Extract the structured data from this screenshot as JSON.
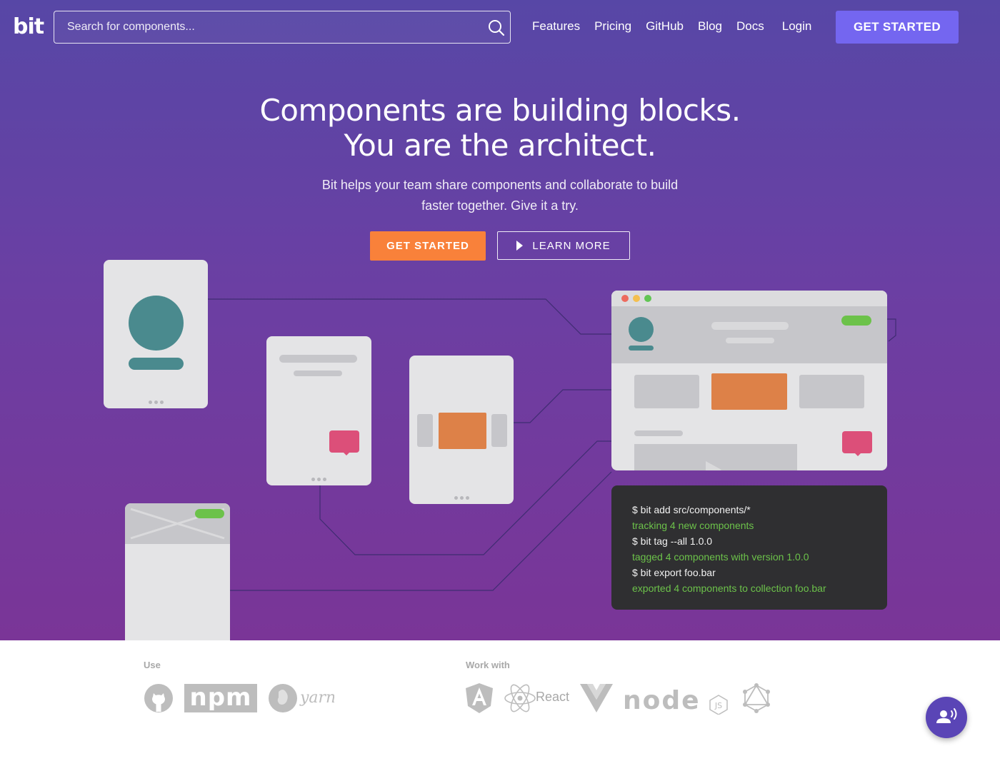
{
  "nav": {
    "logo": "bit",
    "search_placeholder": "Search for components...",
    "links": [
      "Features",
      "Pricing",
      "GitHub",
      "Blog",
      "Docs"
    ],
    "login": "Login",
    "cta": "GET STARTED"
  },
  "hero": {
    "title_line1": "Components are building blocks.",
    "title_line2": "You are the architect.",
    "subtitle_line1": "Bit helps your team share components and collaborate to build",
    "subtitle_line2": "faster together. Give it a try.",
    "primary_button": "GET STARTED",
    "secondary_button": "LEARN MORE"
  },
  "terminal": [
    {
      "type": "cmd",
      "text": "$ bit add src/components/*"
    },
    {
      "type": "out",
      "text": "tracking 4 new components"
    },
    {
      "type": "cmd",
      "text": "$ bit tag --all 1.0.0"
    },
    {
      "type": "out",
      "text": "tagged 4 components with version 1.0.0"
    },
    {
      "type": "cmd",
      "text": "$ bit export foo.bar"
    },
    {
      "type": "out",
      "text": "exported 4 components to collection foo.bar"
    }
  ],
  "bottom": {
    "use_label": "Use",
    "work_label": "Work with",
    "use_logos": [
      "github-logo",
      "npm-logo",
      "yarn-logo"
    ],
    "work_logos": [
      "angular-logo",
      "react-logo",
      "vue-logo",
      "nodejs-logo",
      "graphql-logo"
    ],
    "npm_text": "npm",
    "yarn_text": "yarn",
    "react_text": "React",
    "node_text": "node",
    "node_badge": "JS"
  },
  "colors": {
    "hero_top": "#5747a6",
    "hero_bottom": "#7a3597",
    "accent_orange": "#f9813a",
    "accent_purple": "#7466f0",
    "terminal_green": "#6cc24a"
  }
}
